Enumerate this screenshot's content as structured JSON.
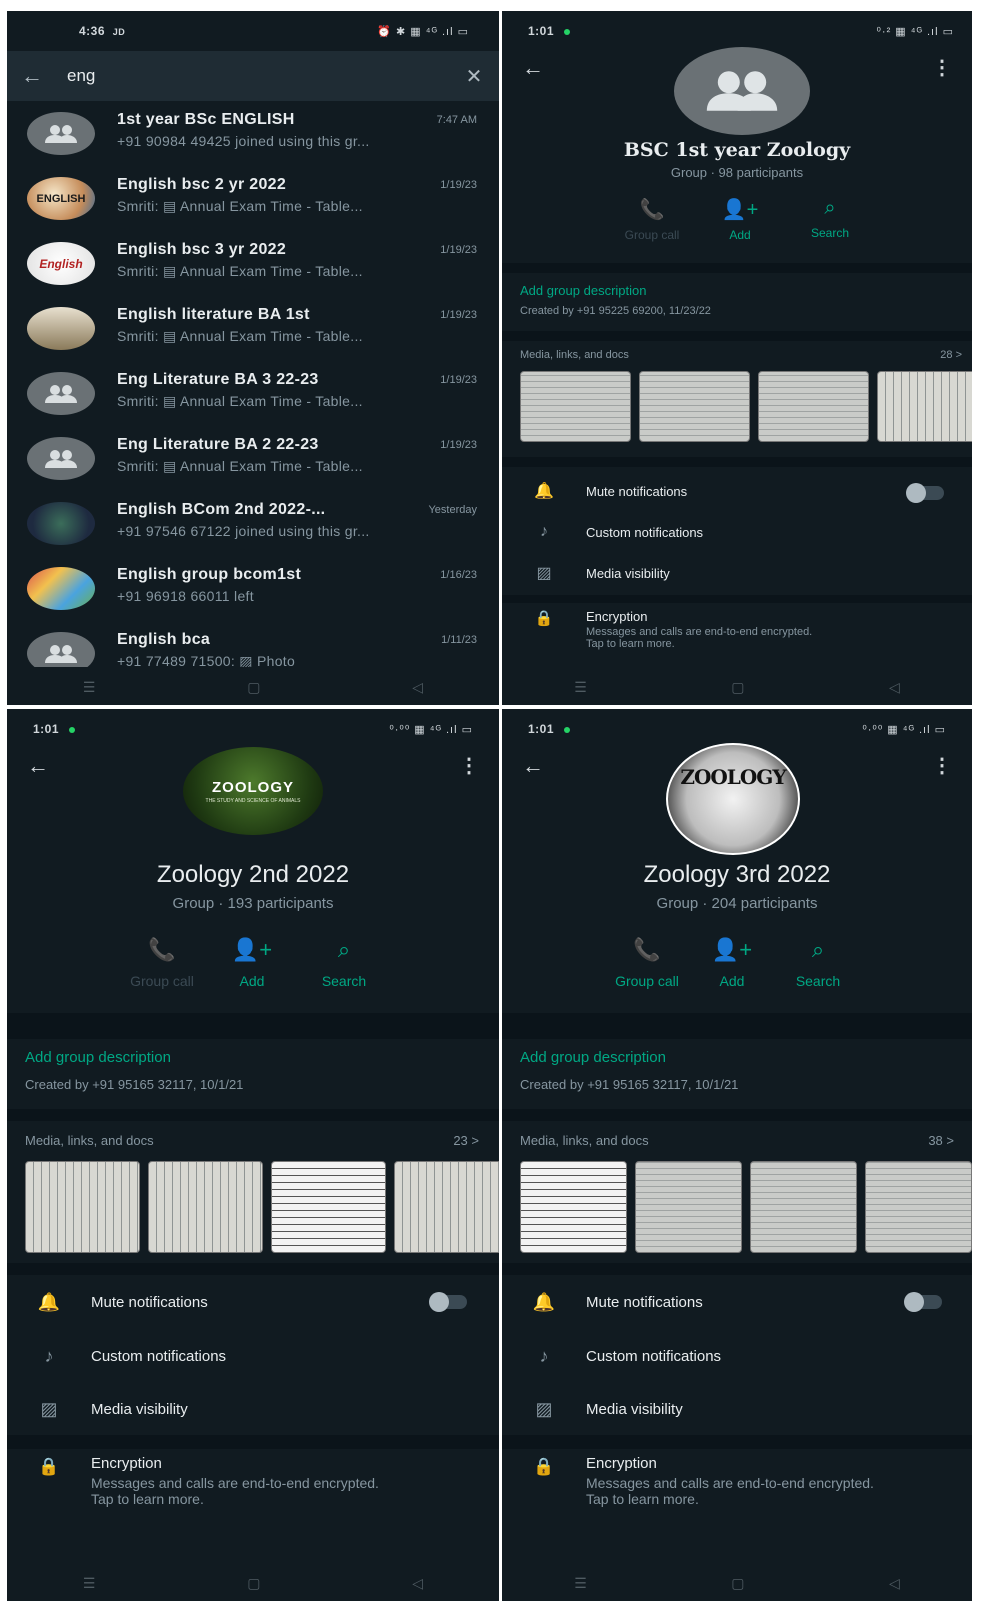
{
  "p1": {
    "status": {
      "time": "4:36",
      "carrier": "JD",
      "icons": "⏰ ✱ ▦ ⁴ᴳ .ıl ▭"
    },
    "search": {
      "back": "←",
      "query": "eng",
      "clear": "✕"
    },
    "chats": [
      {
        "name": "1st year BSc  ENGLISH",
        "date": "7:47 AM",
        "preview": "+91 90984 49425 joined using this gr...",
        "avatar": "group"
      },
      {
        "name": "English bsc 2 yr 2022",
        "date": "1/19/23",
        "preview": "Smriti: ▤ Annual Exam Time - Table...",
        "avatar": "ENGLISH"
      },
      {
        "name": "English bsc 3 yr 2022",
        "date": "1/19/23",
        "preview": "Smriti: ▤ Annual Exam Time - Table...",
        "avatar": "English"
      },
      {
        "name": "English literature BA 1st",
        "date": "1/19/23",
        "preview": "Smriti: ▤ Annual Exam Time - Table...",
        "avatar": ""
      },
      {
        "name": "Eng Literature BA 3 22-23",
        "date": "1/19/23",
        "preview": "Smriti: ▤ Annual Exam Time - Table...",
        "avatar": "group"
      },
      {
        "name": "Eng Literature BA 2 22-23",
        "date": "1/19/23",
        "preview": "Smriti: ▤ Annual Exam Time - Table...",
        "avatar": "group"
      },
      {
        "name": "English  BCom 2nd 2022-...",
        "date": "Yesterday",
        "preview": "+91 97546 67122 joined using this gr...",
        "avatar": ""
      },
      {
        "name": "English group bcom1st",
        "date": "1/16/23",
        "preview": "+91 96918 66011 left",
        "avatar": ""
      },
      {
        "name": "English bca",
        "date": "1/11/23",
        "preview": "+91 77489 71500: ▨ Photo",
        "avatar": "group"
      }
    ]
  },
  "p2": {
    "status": {
      "time": "1:01",
      "icons": "⁰·² ▦ ⁴ᴳ .ıl ▭"
    },
    "name": "BSC 1st year Zoology",
    "meta": "Group · 98 participants",
    "actions": {
      "call": "Group call",
      "add": "Add",
      "search": "Search"
    },
    "desc_add": "Add group description",
    "created": "Created by +91 95225 69200, 11/23/22",
    "media_label": "Media, links, and docs",
    "media_count": "28 >",
    "mute": "Mute notifications",
    "custom": "Custom notifications",
    "visibility": "Media visibility",
    "enc_title": "Encryption",
    "enc_sub1": "Messages and calls are end-to-end encrypted.",
    "enc_sub2": "Tap to learn more."
  },
  "p3": {
    "status": {
      "time": "1:01",
      "icons": "⁰·⁰⁰ ▦ ⁴ᴳ .ıl ▭"
    },
    "avatar_title": "ZOOLOGY",
    "avatar_sub": "THE STUDY AND SCIENCE OF ANIMALS",
    "name": "Zoology 2nd 2022",
    "meta": "Group · 193 participants",
    "actions": {
      "call": "Group call",
      "add": "Add",
      "search": "Search"
    },
    "desc_add": "Add group description",
    "created": "Created by +91 95165 32117, 10/1/21",
    "media_label": "Media, links, and docs",
    "media_count": "23 >",
    "mute": "Mute notifications",
    "custom": "Custom notifications",
    "visibility": "Media visibility",
    "enc_title": "Encryption",
    "enc_sub1": "Messages and calls are end-to-end encrypted.",
    "enc_sub2": "Tap to learn more."
  },
  "p4": {
    "status": {
      "time": "1:01",
      "icons": "⁰·⁰⁰ ▦ ⁴ᴳ .ıl ▭"
    },
    "avatar_title": "ZOOLOGY",
    "name": "Zoology 3rd 2022",
    "meta": "Group · 204 participants",
    "actions": {
      "call": "Group call",
      "add": "Add",
      "search": "Search"
    },
    "desc_add": "Add group description",
    "created": "Created by +91 95165 32117, 10/1/21",
    "media_label": "Media, links, and docs",
    "media_count": "38 >",
    "mute": "Mute notifications",
    "custom": "Custom notifications",
    "visibility": "Media visibility",
    "enc_title": "Encryption",
    "enc_sub1": "Messages and calls are end-to-end encrypted.",
    "enc_sub2": "Tap to learn more."
  },
  "icons": {
    "back": "back-arrow-icon",
    "menu": "more-vert-icon",
    "call": "add-call-icon",
    "add": "add-person-icon",
    "search": "search-icon",
    "mute": "bell-icon",
    "custom": "music-note-icon",
    "visibility": "image-icon",
    "encryption": "lock-icon"
  },
  "colors": {
    "background": "#111b21",
    "accent": "#00a884",
    "muted_text": "#8696a0",
    "separator": "#0b141a"
  }
}
